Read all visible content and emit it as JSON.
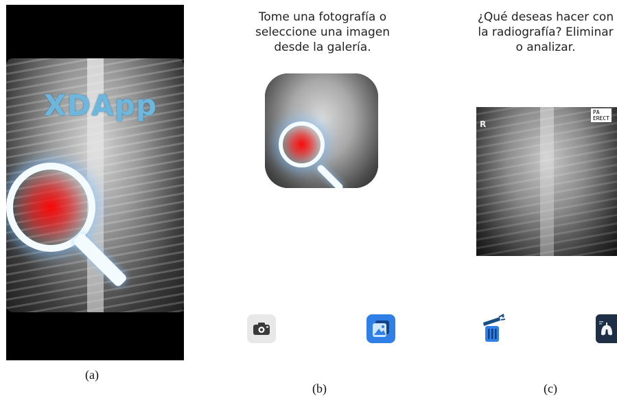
{
  "panel_a": {
    "app_name": "XDApp",
    "caption": "(a)"
  },
  "panel_b": {
    "instruction": "Tome una fotografía o seleccione una imagen desde la galería.",
    "buttons": {
      "camera_icon": "camera-icon",
      "gallery_icon": "gallery-icon"
    },
    "caption": "(b)"
  },
  "panel_c": {
    "question": "¿Qué deseas hacer con la radiografía? Eliminar o analizar.",
    "xray_marker_r": "R",
    "xray_label": "PA\nERECT",
    "buttons": {
      "delete_icon": "trash-icon",
      "analyze_icon": "lungs-icon"
    },
    "caption": "(c)"
  },
  "colors": {
    "accent_blue": "#2f7fe6",
    "app_name_blue": "#6fb6dd",
    "lens_red": "#ff0000"
  }
}
